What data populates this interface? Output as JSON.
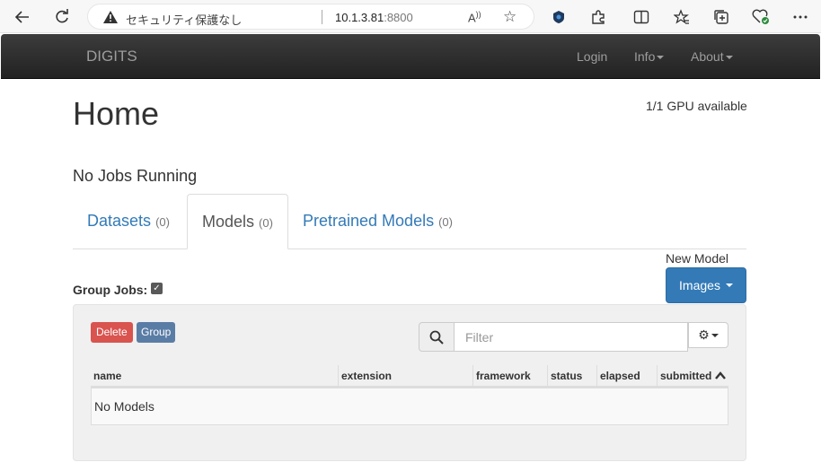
{
  "browser": {
    "security_text": "セキュリティ保護なし",
    "url_host": "10.1.3.81",
    "url_port": ":8800",
    "read_aloud": "Aͅ"
  },
  "navbar": {
    "brand": "DIGITS",
    "login": "Login",
    "info": "Info",
    "about": "About"
  },
  "page": {
    "title": "Home",
    "gpu_status": "1/1 GPU available",
    "jobs_running": "No Jobs Running"
  },
  "tabs": [
    {
      "label": "Datasets",
      "count": "(0)"
    },
    {
      "label": "Models",
      "count": "(0)"
    },
    {
      "label": "Pretrained Models",
      "count": "(0)"
    }
  ],
  "new_model": {
    "label": "New Model",
    "button": "Images"
  },
  "group_jobs": {
    "label": "Group Jobs:",
    "checked": true
  },
  "toolbar": {
    "delete": "Delete",
    "group": "Group",
    "filter_placeholder": "Filter"
  },
  "table": {
    "columns": [
      "name",
      "extension",
      "framework",
      "status",
      "elapsed",
      "submitted"
    ],
    "empty": "No Models"
  },
  "colors": {
    "primary": "#337ab7",
    "danger": "#d9534f",
    "navbar": "#222222"
  }
}
